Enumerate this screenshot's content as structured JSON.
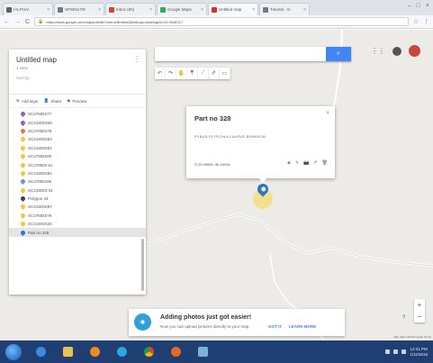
{
  "browser": {
    "tabs": [
      {
        "title": "/ALPHA!",
        "favicon_color": "#5f6368"
      },
      {
        "title": "SPSIN2 FE",
        "favicon_color": "#6b7a88"
      },
      {
        "title": "Inbox (65)",
        "favicon_color": "#d44638"
      },
      {
        "title": "Google Maps",
        "favicon_color": "#34a853"
      },
      {
        "title": "Untitled map",
        "favicon_color": "#d93025"
      },
      {
        "title": "Tutorial - m",
        "favicon_color": "#6b7a88"
      }
    ],
    "url": "https://www.google.com/maps/d/edit?mid=zrBmImsQkM&usp=sharing&ll=24.9948717"
  },
  "panel": {
    "title": "Untitled map",
    "views": "1 view",
    "subtitle": "Sort by...",
    "actions": {
      "add_layer": "Add layer",
      "share": "Share",
      "preview": "Preview"
    },
    "layers": [
      {
        "label": "SC47MDS77",
        "color": "#8e5fc4"
      },
      {
        "label": "SC41WDS58",
        "color": "#8e5fc4"
      },
      {
        "label": "SC47MDS78",
        "color": "#e27a3f"
      },
      {
        "label": "SC41WDS83",
        "color": "#f1c83a"
      },
      {
        "label": "SC41WDS52",
        "color": "#f1c83a"
      },
      {
        "label": "SC47MDS90",
        "color": "#f1c83a"
      },
      {
        "label": "SC47MDS 91",
        "color": "#f1c83a"
      },
      {
        "label": "SC41WDS92",
        "color": "#f1c83a"
      },
      {
        "label": "SC47MDS96",
        "color": "#7b8bd6"
      },
      {
        "label": "SC41WDS 81",
        "color": "#f1c83a"
      },
      {
        "label": "Polygon 44",
        "color": "#444444"
      },
      {
        "label": "SC41WDS97",
        "color": "#f1c83a"
      },
      {
        "label": "SC47MDS79",
        "color": "#f1c83a"
      },
      {
        "label": "SC41WDS26",
        "color": "#f1c83a"
      },
      {
        "label": "Part no 328",
        "color": "#2b77c6"
      }
    ]
  },
  "search": {
    "value": "",
    "placeholder": ""
  },
  "info_window": {
    "title": "Part no 328",
    "description": "PYBUS PLTRCHLA LAUPUE BENNSON",
    "coords": "25.09855, 56.44934"
  },
  "notice": {
    "title": "Adding photos just got easier!",
    "body": "Now you can upload pictures directly to your map.",
    "got_it": "GOT IT",
    "learn_more": "LEARN MORE"
  },
  "map": {
    "attribution": "Map data ©2016 Google  Terms",
    "help": "?"
  },
  "taskbar": {
    "time": "12:21 PM",
    "date": "1/11/2016"
  }
}
